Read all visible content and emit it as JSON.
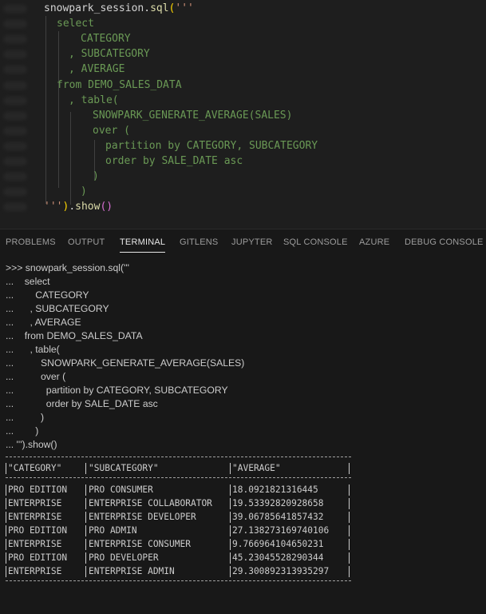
{
  "editor": {
    "lines": [
      {
        "segments": [
          {
            "t": "snowpark_session",
            "c": "tk-plain"
          },
          {
            "t": ".",
            "c": "tk-plain"
          },
          {
            "t": "sql",
            "c": "tk-fn"
          },
          {
            "t": "(",
            "c": "tk-yellow"
          },
          {
            "t": "'''",
            "c": "tk-str"
          }
        ]
      },
      {
        "segments": [
          {
            "t": "select",
            "c": "tk-green"
          }
        ]
      },
      {
        "segments": [
          {
            "t": "CATEGORY",
            "c": "tk-green"
          }
        ]
      },
      {
        "segments": [
          {
            "t": ", SUBCATEGORY",
            "c": "tk-green"
          }
        ]
      },
      {
        "segments": [
          {
            "t": ", AVERAGE",
            "c": "tk-green"
          }
        ]
      },
      {
        "segments": [
          {
            "t": "from DEMO_SALES_DATA",
            "c": "tk-green"
          }
        ]
      },
      {
        "segments": [
          {
            "t": ", table(",
            "c": "tk-green"
          }
        ]
      },
      {
        "segments": [
          {
            "t": "SNOWPARK_GENERATE_AVERAGE(SALES)",
            "c": "tk-green"
          }
        ]
      },
      {
        "segments": [
          {
            "t": "over (",
            "c": "tk-green"
          }
        ]
      },
      {
        "segments": [
          {
            "t": "partition by CATEGORY, SUBCATEGORY",
            "c": "tk-green"
          }
        ]
      },
      {
        "segments": [
          {
            "t": "order by SALE_DATE asc",
            "c": "tk-green"
          }
        ]
      },
      {
        "segments": [
          {
            "t": ")",
            "c": "tk-green"
          }
        ]
      },
      {
        "segments": [
          {
            "t": ")",
            "c": "tk-green"
          }
        ]
      },
      {
        "segments": [
          {
            "t": "'''",
            "c": "tk-str"
          },
          {
            "t": ")",
            "c": "tk-yellow"
          },
          {
            "t": ".",
            "c": "tk-plain"
          },
          {
            "t": "show",
            "c": "tk-fn"
          },
          {
            "t": "()",
            "c": "tk-pink"
          }
        ]
      }
    ]
  },
  "panel": {
    "tabs": [
      "PROBLEMS",
      "OUTPUT",
      "TERMINAL",
      "GITLENS",
      "JUPYTER",
      "SQL CONSOLE",
      "AZURE",
      "DEBUG CONSOLE"
    ],
    "active_tab": "TERMINAL"
  },
  "terminal": {
    "input_lines": [
      ">>> snowpark_session.sql('''",
      "...    select",
      "...        CATEGORY",
      "...      , SUBCATEGORY",
      "...      , AVERAGE",
      "...    from DEMO_SALES_DATA",
      "...      , table(",
      "...          SNOWPARK_GENERATE_AVERAGE(SALES)",
      "...          over (",
      "...            partition by CATEGORY, SUBCATEGORY",
      "...            order by SALE_DATE asc",
      "...          )",
      "...        )",
      "... ''').show()"
    ],
    "table": {
      "headers": [
        "\"CATEGORY\"",
        "\"SUBCATEGORY\"",
        "\"AVERAGE\""
      ],
      "rows": [
        [
          "PRO EDITION",
          "PRO CONSUMER",
          "18.0921821316445"
        ],
        [
          "ENTERPRISE",
          "ENTERPRISE COLLABORATOR",
          "19.53392820928658"
        ],
        [
          "ENTERPRISE",
          "ENTERPRISE DEVELOPER",
          "39.06785641857432"
        ],
        [
          "PRO EDITION",
          "PRO ADMIN",
          "27.138273169740106"
        ],
        [
          "ENTERPRISE",
          "ENTERPRISE CONSUMER",
          "9.766964104650231"
        ],
        [
          "PRO EDITION",
          "PRO DEVELOPER",
          "45.23045528290344"
        ],
        [
          "ENTERPRISE",
          "ENTERPRISE ADMIN",
          "29.300892313935297"
        ]
      ]
    }
  }
}
